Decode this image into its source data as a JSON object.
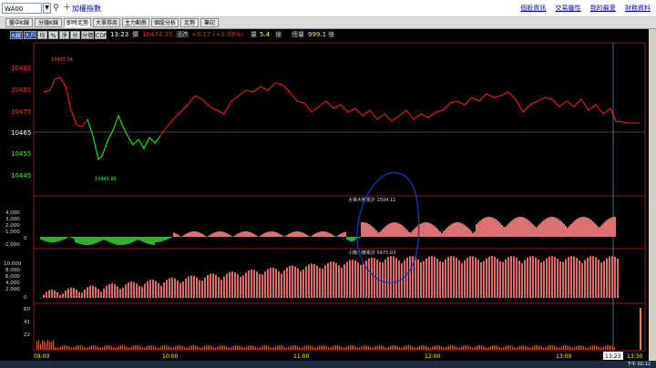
{
  "header": {
    "search_value": "WA00",
    "title": "加權指數",
    "links": [
      "個股資訊",
      "交易屬性",
      "我的最愛",
      "財務資料"
    ]
  },
  "tabs": [
    "盤中K線",
    "分鐘K線",
    "即時走勢",
    "大單券商",
    "主力動態",
    "個股分析",
    "走勢",
    "筆記"
  ],
  "active_tab": 2,
  "toolbar": {
    "buttons": [
      "K線",
      "大戶",
      "均",
      "%",
      "淨",
      "分",
      "分價",
      "CDP"
    ],
    "active_buttons": [
      0,
      1
    ],
    "time": "13:23",
    "price_label": "價",
    "price": "10474.35",
    "change_label": "漲跌",
    "change": "+9.17 (+0.09%)",
    "volume_label": "量",
    "volume": "5.4",
    "volume_unit": "億",
    "total_label": "總量",
    "total": "999.1",
    "total_unit": "億"
  },
  "chart": {
    "price_ticks": [
      "10495",
      "10485",
      "10475",
      "10465",
      "10455",
      "10445"
    ],
    "reference_price": "10465",
    "high_label": "10495.34",
    "low_label": "10445.86",
    "big_label": "大單大散累計 2504.12",
    "big_ticks": [
      "4,000",
      "3,000",
      "2,000",
      "1,000",
      "0",
      "-1,000"
    ],
    "small_label": "小散小散累計 5475.03",
    "small_ticks": [
      "10,000",
      "8,000",
      "6,000",
      "4,000",
      "2,000",
      "0"
    ],
    "vol_ticks": [
      "60",
      "41",
      "22"
    ],
    "time_ticks": [
      "09:00",
      "10:00",
      "11:00",
      "12:00",
      "13:00",
      "13:30"
    ],
    "cursor_time": "13:23"
  },
  "taskbar": {
    "clock": "下午 02:12"
  }
}
